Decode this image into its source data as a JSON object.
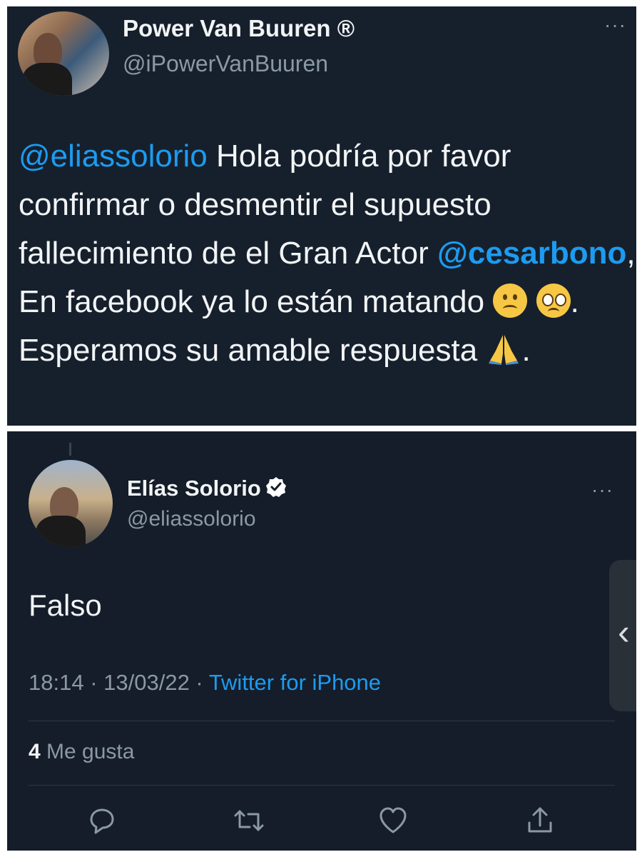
{
  "top_tweet": {
    "display_name": "Power Van Buuren ®",
    "handle": "@iPowerVanBuuren",
    "more_label": "···",
    "body": {
      "mention_1": "@eliassolorio",
      "text_1": " Hola podría por favor confirmar o desmentir el supuesto fallecimiento de el Gran Actor ",
      "mention_2": "@cesarbono",
      "text_2": ", En facebook ya lo están matando ",
      "text_3": ". Esperamos su amable respuesta ",
      "text_4": "."
    },
    "emojis": [
      "frowning-face",
      "pleading-face",
      "folded-hands"
    ]
  },
  "bottom_tweet": {
    "display_name": "Elías Solorio",
    "verified": true,
    "handle": "@eliassolorio",
    "more_label": "···",
    "body": "Falso",
    "time": "18:14",
    "date": "13/03/22",
    "separator": " · ",
    "source": "Twitter for iPhone",
    "likes_count": "4",
    "likes_label": " Me gusta",
    "actions": [
      "reply-icon",
      "retweet-icon",
      "like-icon",
      "share-icon"
    ]
  },
  "side_handle": {
    "chevron": "‹"
  },
  "colors": {
    "background": "#16202c",
    "text": "#f2f4f6",
    "secondary": "#8b98a5",
    "accent": "#1d9bf0",
    "verified": "#ffffff"
  }
}
